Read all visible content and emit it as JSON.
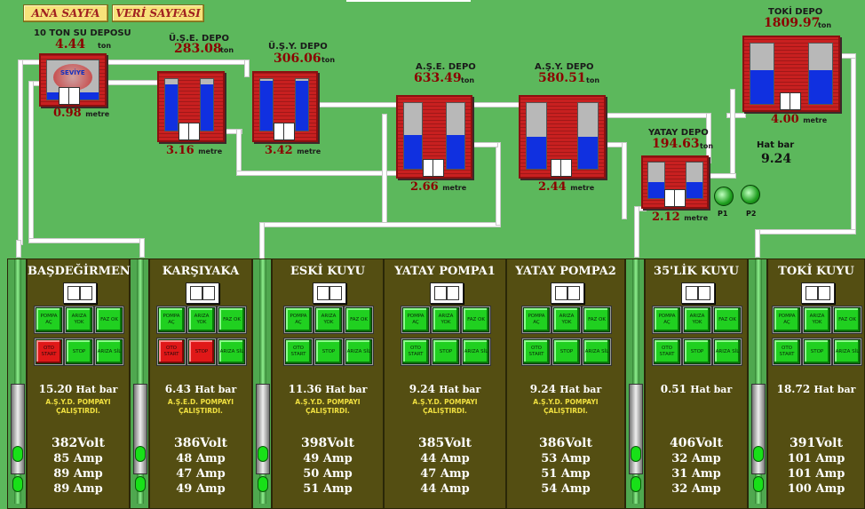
{
  "nav": {
    "home": "ANA SAYFA",
    "data": "VERİ SAYFASI"
  },
  "depots": {
    "ton10": {
      "name": "10 TON SU DEPOSU",
      "value": "4.44",
      "unit": "ton",
      "level": "0.98",
      "level_unit": "metre",
      "overlay": "SEVİYE"
    },
    "use": {
      "name": "Ü.Ş.E. DEPO",
      "value": "283.08",
      "unit": "ton",
      "level": "3.16",
      "level_unit": "metre"
    },
    "usy": {
      "name": "Ü.Ş.Y. DEPO",
      "value": "306.06",
      "unit": "ton",
      "level": "3.42",
      "level_unit": "metre"
    },
    "ase": {
      "name": "A.Ş.E. DEPO",
      "value": "633.49",
      "unit": "ton",
      "level": "2.66",
      "level_unit": "metre"
    },
    "asy": {
      "name": "A.Ş.Y. DEPO",
      "value": "580.51",
      "unit": "ton",
      "level": "2.44",
      "level_unit": "metre"
    },
    "yatay": {
      "name": "YATAY DEPO",
      "value": "194.63",
      "unit": "ton",
      "level": "2.12",
      "level_unit": "metre"
    },
    "toki": {
      "name": "TOKİ DEPO",
      "value": "1809.97",
      "unit": "ton",
      "level": "4.00",
      "level_unit": "metre"
    }
  },
  "hatbar_top": {
    "label": "Hat bar",
    "value": "9.24"
  },
  "pumps": {
    "p1": "P1",
    "p2": "P2"
  },
  "stations": [
    {
      "title": "BAŞDEĞİRMEN",
      "hat": "15.20",
      "hat_unit": "Hat bar",
      "note1": "A.Ş.Y.D. POMPAYI",
      "note2": "ÇALIŞTIRDI.",
      "volt": "382",
      "amps": [
        "85",
        "89",
        "89"
      ],
      "buttons": [
        "POMPA AÇ",
        "ARIZA YOK",
        "FAZ OK",
        "OTO START",
        "STOP",
        "ARIZA SİL"
      ],
      "red": [
        3
      ]
    },
    {
      "title": "KARŞIYAKA",
      "hat": "6.43",
      "hat_unit": "Hat bar",
      "note1": "A.Ş.E.D. POMPAYI",
      "note2": "ÇALIŞTIRDI.",
      "volt": "386",
      "amps": [
        "48",
        "47",
        "49"
      ],
      "buttons": [
        "POMPA AÇ",
        "ARIZA YOK",
        "FAZ OK",
        "OTO START",
        "STOP",
        "ARIZA SİL"
      ],
      "red": [
        3,
        4
      ]
    },
    {
      "title": "ESKİ KUYU",
      "hat": "11.36",
      "hat_unit": "Hat bar",
      "note1": "A.Ş.Y.D. POMPAYI",
      "note2": "ÇALIŞTIRDI.",
      "volt": "398",
      "amps": [
        "49",
        "50",
        "51"
      ],
      "buttons": [
        "POMPA AÇ",
        "ARIZA YOK",
        "FAZ OK",
        "OTO START",
        "STOP",
        "ARIZA SİL"
      ],
      "red": []
    },
    {
      "title": "YATAY POMPA1",
      "hat": "9.24",
      "hat_unit": "Hat bar",
      "note1": "A.Ş.Y.D. POMPAYI",
      "note2": "ÇALIŞTIRDI.",
      "volt": "385",
      "amps": [
        "44",
        "47",
        "44"
      ],
      "buttons": [
        "POMPA AÇ",
        "ARIZA YOK",
        "FAZ OK",
        "OTO START",
        "STOP",
        "ARIZA SİL"
      ],
      "red": []
    },
    {
      "title": "YATAY POMPA2",
      "hat": "9.24",
      "hat_unit": "Hat bar",
      "note1": "A.Ş.Y.D. POMPAYI",
      "note2": "ÇALIŞTIRDI.",
      "volt": "386",
      "amps": [
        "53",
        "51",
        "54"
      ],
      "buttons": [
        "POMPA AÇ",
        "ARIZA YOK",
        "FAZ OK",
        "OTO START",
        "STOP",
        "ARIZA SİL"
      ],
      "red": []
    },
    {
      "title": "35'LİK KUYU",
      "hat": "0.51",
      "hat_unit": "Hat bar",
      "note1": "",
      "note2": "",
      "volt": "406",
      "amps": [
        "32",
        "31",
        "32"
      ],
      "buttons": [
        "POMPA AÇ",
        "ARIZA YOK",
        "FAZ OK",
        "OTO START",
        "STOP",
        "ARIZA SİL"
      ],
      "red": []
    },
    {
      "title": "TOKİ KUYU",
      "hat": "18.72",
      "hat_unit": "Hat bar",
      "note1": "",
      "note2": "",
      "volt": "391",
      "amps": [
        "101",
        "101",
        "100"
      ],
      "buttons": [
        "POMPA AÇ",
        "ARIZA YOK",
        "FAZ OK",
        "OTO START",
        "STOP",
        "ARIZA SİL"
      ],
      "red": []
    }
  ],
  "volt_unit": "Volt",
  "amp_unit": "Amp",
  "colors": {
    "background": "#5cb85c",
    "panel": "#544e12",
    "tank_brick": "#c82020",
    "water": "#1030e0",
    "button_green": "#20d020",
    "button_red": "#e01818",
    "value_text": "#8b0000"
  }
}
